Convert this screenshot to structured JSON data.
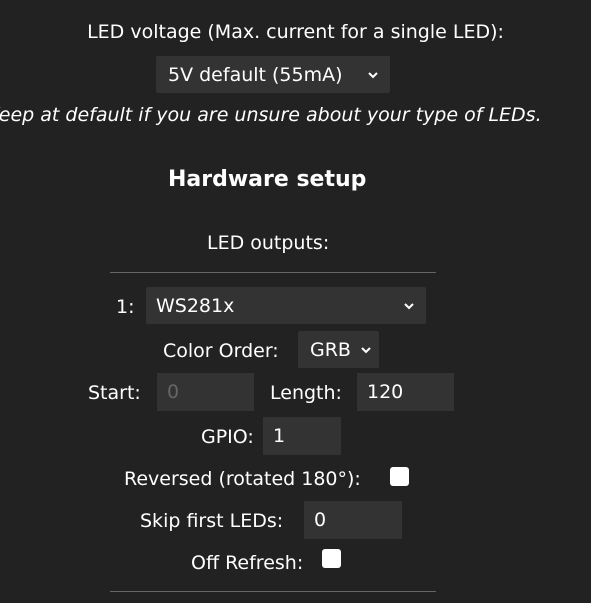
{
  "led_voltage": {
    "label": "LED voltage (Max. current for a single LED):",
    "selected": "5V default (55mA)",
    "hint": "Keep at default if you are unsure about your type of LEDs."
  },
  "hardware": {
    "title": "Hardware setup",
    "outputs_label": "LED outputs:"
  },
  "output1": {
    "index_label": "1:",
    "type_selected": "WS281x",
    "color_order_label": "Color Order:",
    "color_order_selected": "GRB",
    "start_label": "Start:",
    "start_placeholder": "0",
    "length_label": "Length:",
    "length_value": "120",
    "gpio_label": "GPIO:",
    "gpio_value": "1",
    "reversed_label": "Reversed (rotated 180°):",
    "reversed_checked": false,
    "skip_label": "Skip first LEDs:",
    "skip_value": "0",
    "off_refresh_label": "Off Refresh:",
    "off_refresh_checked": false
  },
  "icons": {
    "dropdown": "chevron-down-icon"
  },
  "colors": {
    "background": "#222222",
    "field": "#333333",
    "text": "#ffffff",
    "divider": "#666666"
  }
}
